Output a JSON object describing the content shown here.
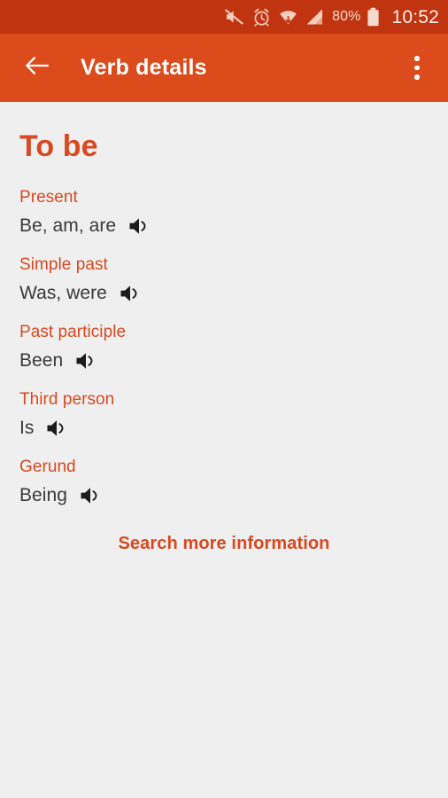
{
  "status_bar": {
    "icons": [
      {
        "name": "mute-icon",
        "label": "sound muted"
      },
      {
        "name": "alarm-clock-icon",
        "label": "alarm set"
      },
      {
        "name": "wifi-download-icon",
        "label": "wifi connected"
      },
      {
        "name": "signal-bars-icon",
        "label": "cellular signal"
      }
    ],
    "battery_percent": "80%",
    "battery_icon": "battery-icon",
    "time": "10:52",
    "background_color": "#C03510"
  },
  "app_bar": {
    "back_icon": "back-arrow-icon",
    "title": "Verb details",
    "overflow_icon": "overflow-menu-icon",
    "background_color": "#DB4B1C",
    "title_color": "#FFFFFF"
  },
  "content": {
    "verb_title": "To be",
    "accent_color": "#D9481E",
    "background_color": "#EFEFEF",
    "sections": [
      {
        "label": "Present",
        "value": "Be, am, are",
        "speaker_icon": "speaker-icon"
      },
      {
        "label": "Simple past",
        "value": "Was, were",
        "speaker_icon": "speaker-icon"
      },
      {
        "label": "Past participle",
        "value": "Been",
        "speaker_icon": "speaker-icon"
      },
      {
        "label": "Third person",
        "value": "Is",
        "speaker_icon": "speaker-icon"
      },
      {
        "label": "Gerund",
        "value": "Being",
        "speaker_icon": "speaker-icon"
      }
    ],
    "search_link": "Search more information"
  }
}
